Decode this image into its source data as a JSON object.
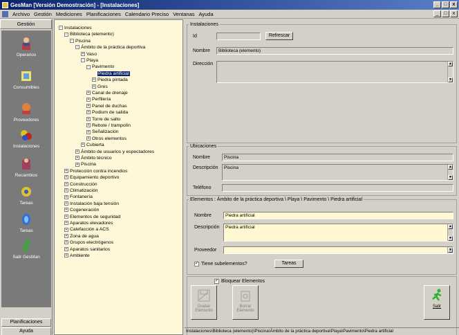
{
  "window": {
    "title": "GesMan [Versión Demostración] - [Instalaciones]",
    "buttons": [
      "_",
      "□",
      "x"
    ]
  },
  "menubar": {
    "items": [
      "Archivo",
      "Gestión",
      "Mediciones",
      "Planificaciones",
      "Calendario Preciso",
      "Ventanas",
      "Ayuda"
    ]
  },
  "leftbar": {
    "header": "Gestión",
    "buttons": [
      {
        "label": "Operarios",
        "icon": "operator-icon"
      },
      {
        "label": "Consumibles",
        "icon": "consumables-icon"
      },
      {
        "label": "Proveedores",
        "icon": "suppliers-icon"
      },
      {
        "label": "Instalaciones",
        "icon": "installations-icon"
      },
      {
        "label": "Recambios",
        "icon": "spare-parts-icon"
      },
      {
        "label": "Tareas",
        "icon": "tasks-icon"
      },
      {
        "label": "Tareas",
        "icon": "tasks2-icon"
      },
      {
        "label": "Salir GesMan",
        "icon": "exit-runner-icon"
      }
    ],
    "bottom": [
      "Planificaciones",
      "Ayuda"
    ]
  },
  "tree": [
    {
      "label": "Instalaciones",
      "d": 0,
      "box": "-"
    },
    {
      "label": "Biblioteca (elemento)",
      "d": 1,
      "box": "-"
    },
    {
      "label": "Piscina",
      "d": 2,
      "box": "-"
    },
    {
      "label": "Ámbito de la práctica deportiva",
      "d": 3,
      "box": "-"
    },
    {
      "label": "Vaso",
      "d": 4,
      "box": "+"
    },
    {
      "label": "Playa",
      "d": 4,
      "box": "-"
    },
    {
      "label": "Pavimento",
      "d": 5,
      "box": "-"
    },
    {
      "label": "Piedra artificial",
      "d": 6,
      "box": "",
      "sel": true
    },
    {
      "label": "Piedra pintada",
      "d": 6,
      "box": "+"
    },
    {
      "label": "Gres",
      "d": 6,
      "box": "+"
    },
    {
      "label": "Canal de drenaje",
      "d": 5,
      "box": "+"
    },
    {
      "label": "Perfilería",
      "d": 5,
      "box": "+"
    },
    {
      "label": "Panel de duchas",
      "d": 5,
      "box": "+"
    },
    {
      "label": "Podium de salida",
      "d": 5,
      "box": "+"
    },
    {
      "label": "Torre de salto",
      "d": 5,
      "box": "+"
    },
    {
      "label": "Rebote / trampolín",
      "d": 5,
      "box": "+"
    },
    {
      "label": "Señalización",
      "d": 5,
      "box": "+"
    },
    {
      "label": "Otros elementos",
      "d": 5,
      "box": "+"
    },
    {
      "label": "Cubierta",
      "d": 4,
      "box": "+"
    },
    {
      "label": "Ámbito de usuarios y espectadores",
      "d": 3,
      "box": "+"
    },
    {
      "label": "Ámbito técnico",
      "d": 3,
      "box": "+"
    },
    {
      "label": "Piscina",
      "d": 3,
      "box": "+"
    },
    {
      "label": "Protección contra incendios",
      "d": 1,
      "box": "+"
    },
    {
      "label": "Equipamiento deportivo",
      "d": 1,
      "box": "+"
    },
    {
      "label": "Construcción",
      "d": 1,
      "box": "+"
    },
    {
      "label": "Climatización",
      "d": 1,
      "box": "+"
    },
    {
      "label": "Fontanería",
      "d": 1,
      "box": "+"
    },
    {
      "label": "Instalación baja tensión",
      "d": 1,
      "box": "+"
    },
    {
      "label": "Cogeneración",
      "d": 1,
      "box": "+"
    },
    {
      "label": "Elementos de seguridad",
      "d": 1,
      "box": "+"
    },
    {
      "label": "Aparatos elevadores",
      "d": 1,
      "box": "+"
    },
    {
      "label": "Calefacción a ACS",
      "d": 1,
      "box": "+"
    },
    {
      "label": "Zona de agua",
      "d": 1,
      "box": "+"
    },
    {
      "label": "Grupos electrógenos",
      "d": 1,
      "box": "+"
    },
    {
      "label": "Aparatos sanitarios",
      "d": 1,
      "box": "+"
    },
    {
      "label": "Ambiente",
      "d": 1,
      "box": "+"
    }
  ],
  "instalaciones": {
    "legend": "Instalaciones",
    "id_label": "Id",
    "id_value": "",
    "refresh_button": "Refrescar",
    "nombre_label": "Nombre",
    "nombre_value": "Biblioteca (elemento)",
    "direccion_label": "Dirección",
    "direccion_value": ""
  },
  "ubicaciones": {
    "legend": "Ubicaciones",
    "nombre_label": "Nombre",
    "nombre_value": "Piscina",
    "descripcion_label": "Descripción",
    "descripcion_value": "Piscina",
    "telefono_label": "Teléfono",
    "telefono_value": ""
  },
  "elementos": {
    "legend": "Elementos : Ámbito de la práctica deportiva \\ Playa \\ Pavimento \\ Piedra artificial",
    "nombre_label": "Nombre",
    "nombre_value": "Piedra artificial",
    "descripcion_label": "Descripción",
    "descripcion_value": "Piedra artificial",
    "proveedor_label": "Proveedor",
    "proveedor_value": "",
    "checkbox_label": "Tiene subelementos?",
    "checkbox_checked": true,
    "fichas_button": "Tareas"
  },
  "bloquear": {
    "label": "Bloquear Elementos",
    "checked": true
  },
  "actions": {
    "save": "Grabar Elemento",
    "delete": "Borrar Elemento",
    "exit": "Salir"
  },
  "statusbar": "Instalaciones\\Biblioteca (elemento)\\Piscina\\Ámbito de la práctica deportiva\\Playa\\Pavimento\\Piedra artificial"
}
